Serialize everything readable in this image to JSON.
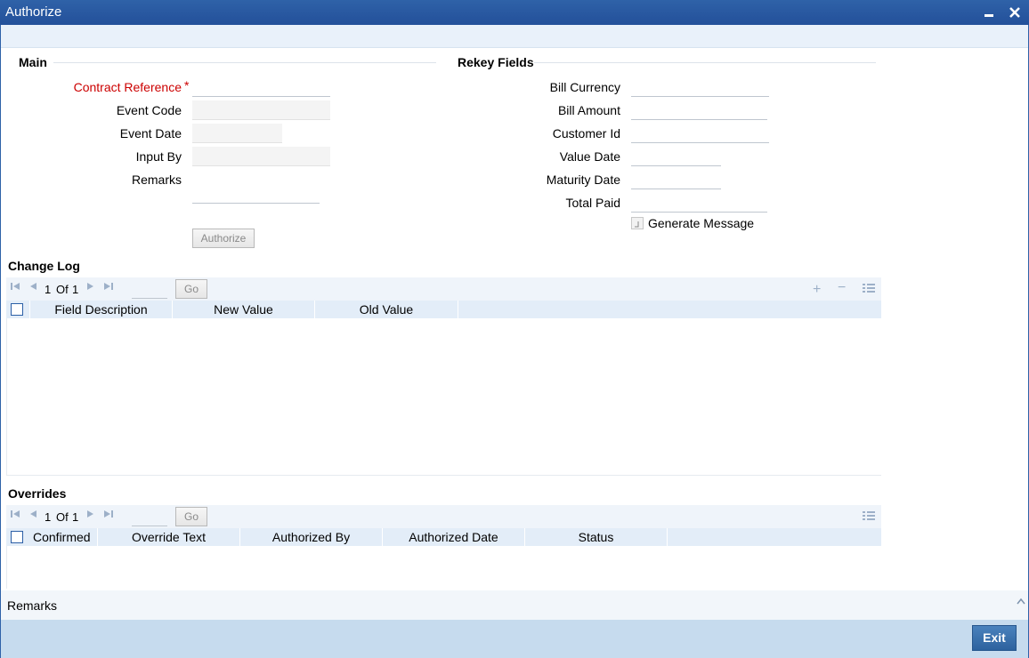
{
  "window": {
    "title": "Authorize"
  },
  "main": {
    "title": "Main",
    "fields": [
      {
        "label": "Contract Reference",
        "value": ""
      },
      {
        "label": "Event Code",
        "value": ""
      },
      {
        "label": "Event Date",
        "value": ""
      },
      {
        "label": "Input By",
        "value": ""
      },
      {
        "label": "Remarks",
        "value": ""
      }
    ],
    "required_marker": "*",
    "authorize_button": "Authorize"
  },
  "rekey": {
    "title": "Rekey Fields",
    "fields": [
      {
        "label": "Bill Currency",
        "value": ""
      },
      {
        "label": "Bill Amount",
        "value": ""
      },
      {
        "label": "Customer Id",
        "value": ""
      },
      {
        "label": "Value Date",
        "value": ""
      },
      {
        "label": "Maturity Date",
        "value": ""
      },
      {
        "label": "Total Paid",
        "value": ""
      }
    ],
    "generate_message": "Generate Message"
  },
  "change_log": {
    "title": "Change Log",
    "page_current": "1",
    "page_of": "Of",
    "page_total": "1",
    "go_label": "Go",
    "columns": [
      "Field Description",
      "New Value",
      "Old Value"
    ]
  },
  "overrides": {
    "title": "Overrides",
    "page_current": "1",
    "page_of": "Of",
    "page_total": "1",
    "go_label": "Go",
    "columns": [
      "Confirmed",
      "Override Text",
      "Authorized By",
      "Authorized Date",
      "Status"
    ]
  },
  "remarks_bar": {
    "label": "Remarks"
  },
  "footer": {
    "exit_label": "Exit"
  },
  "colors": {
    "title_bar": "#2f62a8",
    "footer": "#c6dbee",
    "required": "#cc0000",
    "exit_button": "#3a72b0"
  }
}
